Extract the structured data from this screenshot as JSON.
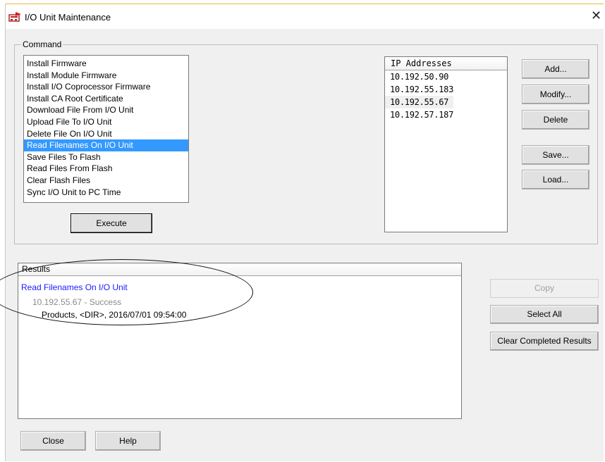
{
  "window": {
    "title": "I/O Unit Maintenance",
    "close_glyph": "✕",
    "icon": "io-unit-icon"
  },
  "command": {
    "group_label": "Command",
    "items": [
      "Install Firmware",
      "Install Module Firmware",
      "Install I/O Coprocessor Firmware",
      "Install CA Root Certificate",
      "Download File From I/O Unit",
      "Upload File To I/O Unit",
      "Delete File On I/O Unit",
      "Read Filenames On I/O Unit",
      "Save Files To Flash",
      "Read Files From Flash",
      "Clear Flash Files",
      "Sync I/O Unit to PC Time"
    ],
    "selected_index": 7,
    "execute_label": "Execute"
  },
  "ip": {
    "header": "IP Addresses",
    "items": [
      "10.192.50.90",
      "10.192.55.183",
      "10.192.55.67",
      "10.192.57.187"
    ],
    "highlighted_index": 2,
    "buttons": {
      "add": "Add...",
      "modify": "Modify...",
      "delete": "Delete",
      "save": "Save...",
      "load": "Load..."
    }
  },
  "results": {
    "header": "Results",
    "command": "Read Filenames On I/O Unit",
    "status": "10.192.55.67 - Success",
    "entry": "Products, <DIR>, 2016/07/01 09:54:00",
    "buttons": {
      "copy": "Copy",
      "select_all": "Select All",
      "clear_completed": "Clear Completed Results"
    }
  },
  "footer": {
    "close": "Close",
    "help": "Help"
  },
  "colors": {
    "selection": "#3399ff",
    "result_command": "#1a1aff",
    "result_status": "#8a8a8a"
  }
}
